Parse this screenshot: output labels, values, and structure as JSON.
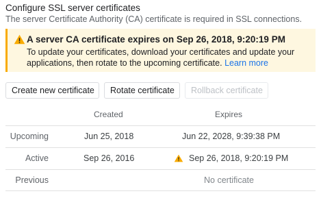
{
  "header": {
    "title": "Configure SSL server certificates",
    "subtitle": "The server Certificate Authority (CA) certificate is required in SSL connections."
  },
  "alert": {
    "icon": "warning-icon",
    "heading": "A server CA certificate expires on Sep 26, 2018, 9:20:19 PM",
    "body": "To update your certificates, download your certificates and update your applications, then rotate to the upcoming certificate.",
    "link_label": "Learn more",
    "color_accent": "#f9ab00",
    "color_background": "#fef7e0"
  },
  "actions": {
    "create_label": "Create new certificate",
    "rotate_label": "Rotate certificate",
    "rollback_label": "Rollback certificate"
  },
  "table": {
    "headers": {
      "created": "Created",
      "expires": "Expires"
    },
    "rows": [
      {
        "label": "Upcoming",
        "created": "Jun 25, 2018",
        "expires": "Jun 22, 2028, 9:39:38 PM",
        "warning": false
      },
      {
        "label": "Active",
        "created": "Sep 26, 2016",
        "expires": "Sep 26, 2018, 9:20:19 PM",
        "warning": true
      },
      {
        "label": "Previous",
        "created": "",
        "expires": "No certificate",
        "warning": false
      }
    ]
  }
}
